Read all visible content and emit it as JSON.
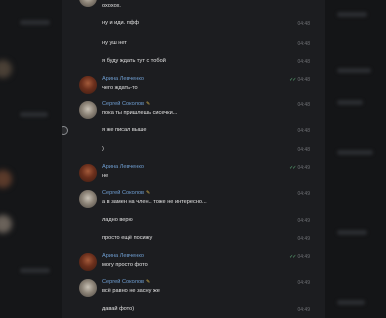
{
  "messages": [
    {
      "text": "охохох.",
      "time": ""
    },
    {
      "text": "ну и иди. пфф",
      "time": "04:48"
    },
    {
      "text": "ну уш нет",
      "time": "04:48"
    },
    {
      "text": "я буду ждать тут с тобой",
      "time": "04:48"
    },
    {
      "author": "Арина Левченко",
      "text": "чего ждать-то",
      "time": "04:48",
      "read": "✓✓"
    },
    {
      "author": "Сергей Соколов",
      "badge": "✎",
      "text": "пока ты пришлешь сисечки...",
      "time": "04:48"
    },
    {
      "text": "я же писал выше",
      "time": "04:48"
    },
    {
      "text": ")",
      "time": "04:48"
    },
    {
      "author": "Арина Левченко",
      "text": "не",
      "time": "04:49",
      "read": "✓✓"
    },
    {
      "author": "Сергей Соколов",
      "badge": "✎",
      "text": "а в замен на член.. тоже не интересно...",
      "time": "04:49"
    },
    {
      "text": "ладно верю",
      "time": "04:49"
    },
    {
      "text": "просто ещё посижу",
      "time": "04:49"
    },
    {
      "author": "Арина Левченко",
      "text": "могу просто фото",
      "time": "04:49",
      "read": "✓✓"
    },
    {
      "author": "Сергей Соколов",
      "badge": "✎",
      "text": "всё равно не засну же",
      "time": "04:49"
    },
    {
      "text": "давай фото)",
      "time": "04:49"
    }
  ]
}
